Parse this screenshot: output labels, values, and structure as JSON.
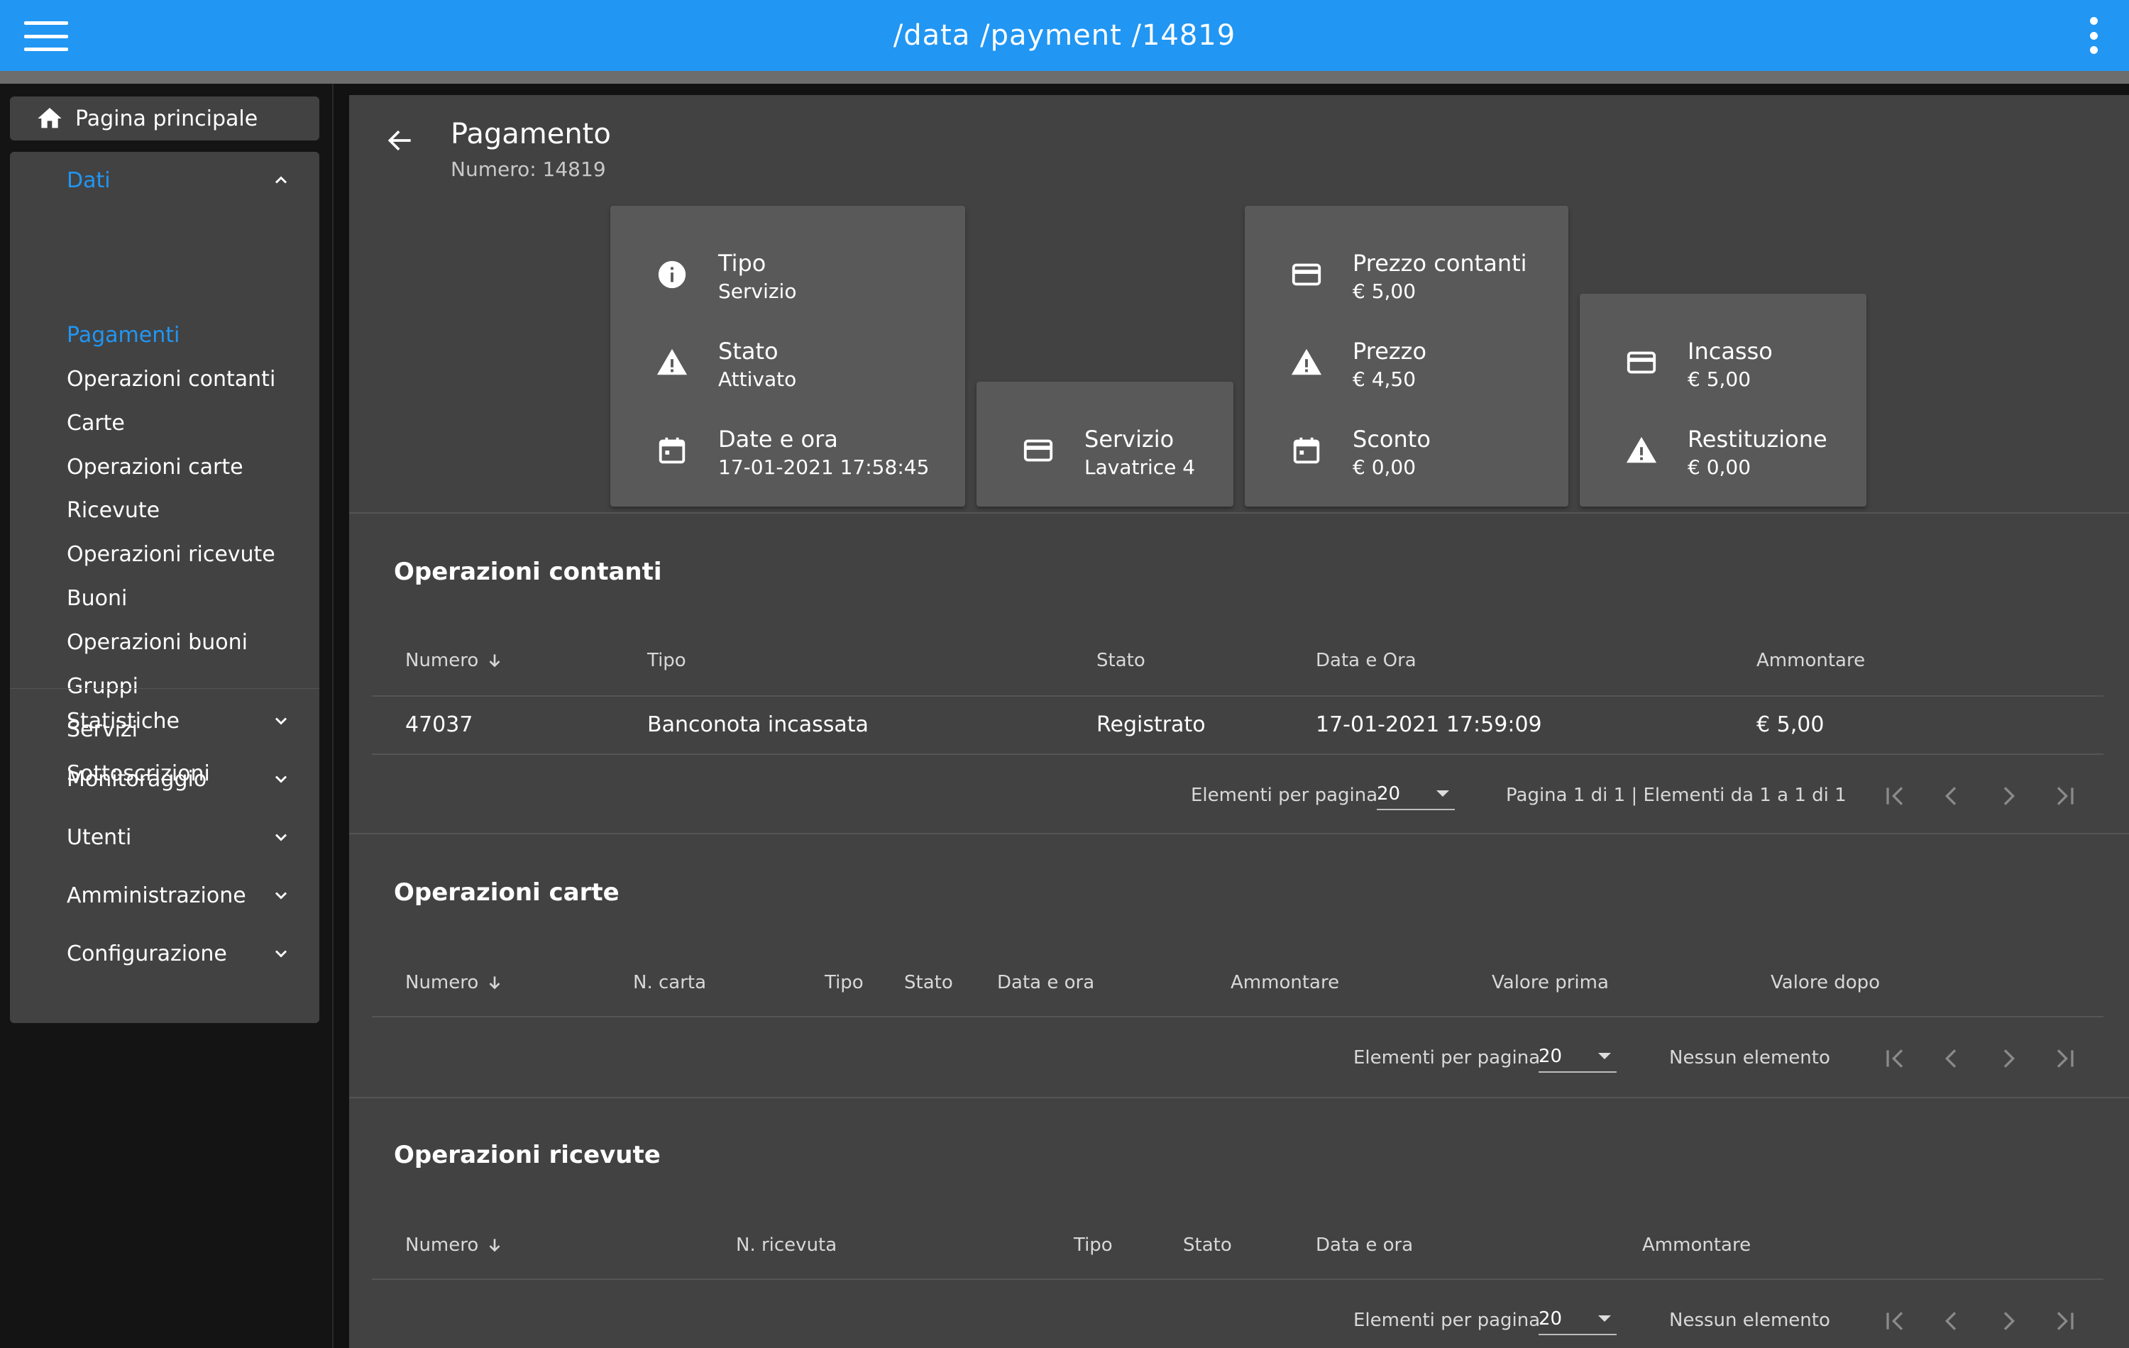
{
  "topbar": {
    "title": "/data /payment /14819"
  },
  "sidebar": {
    "home_label": "Pagina principale",
    "groups": [
      {
        "label": "Dati",
        "expanded": true,
        "items": [
          "Pagamenti",
          "Operazioni contanti",
          "Carte",
          "Operazioni carte",
          "Ricevute",
          "Operazioni ricevute",
          "Buoni",
          "Operazioni buoni",
          "Gruppi",
          "Servizi",
          "Sottoscrizioni"
        ],
        "active_item": "Pagamenti"
      },
      {
        "label": "Statistiche",
        "expanded": false
      },
      {
        "label": "Monitoraggio",
        "expanded": false
      },
      {
        "label": "Utenti",
        "expanded": false
      },
      {
        "label": "Amministrazione",
        "expanded": false
      },
      {
        "label": "Configurazione",
        "expanded": false
      }
    ]
  },
  "page": {
    "title": "Pagamento",
    "subtitle": "Numero: 14819"
  },
  "cards": {
    "card1": [
      {
        "icon": "info-icon",
        "label": "Tipo",
        "value": "Servizio"
      },
      {
        "icon": "warning-icon",
        "label": "Stato",
        "value": "Attivato"
      },
      {
        "icon": "calendar-icon",
        "label": "Date e ora",
        "value": "17-01-2021 17:58:45"
      }
    ],
    "card2": [
      {
        "icon": "credit-card-icon",
        "label": "Servizio",
        "value": "Lavatrice 4"
      }
    ],
    "card3": [
      {
        "icon": "credit-card-icon",
        "label": "Prezzo contanti",
        "value": "€ 5,00"
      },
      {
        "icon": "warning-icon",
        "label": "Prezzo",
        "value": "€ 4,50"
      },
      {
        "icon": "calendar-icon",
        "label": "Sconto",
        "value": "€ 0,00"
      }
    ],
    "card4": [
      {
        "icon": "credit-card-icon",
        "label": "Incasso",
        "value": "€ 5,00"
      },
      {
        "icon": "warning-icon",
        "label": "Restituzione",
        "value": "€ 0,00"
      }
    ]
  },
  "cash_ops": {
    "title": "Operazioni contanti",
    "columns": [
      "Numero",
      "Tipo",
      "Stato",
      "Data e Ora",
      "Ammontare"
    ],
    "rows": [
      {
        "numero": "47037",
        "tipo": "Banconota incassata",
        "stato": "Registrato",
        "data": "17-01-2021 17:59:09",
        "ammontare": "€ 5,00"
      }
    ],
    "per_page_label": "Elementi per pagina",
    "per_page": "20",
    "range_text": "Pagina 1 di 1 | Elementi da 1 a 1 di 1"
  },
  "card_ops": {
    "title": "Operazioni carte",
    "columns": [
      "Numero",
      "N. carta",
      "Tipo",
      "Stato",
      "Data e ora",
      "Ammontare",
      "Valore prima",
      "Valore dopo"
    ],
    "per_page_label": "Elementi per pagina",
    "per_page": "20",
    "range_text": "Nessun elemento"
  },
  "receipt_ops": {
    "title": "Operazioni ricevute",
    "columns": [
      "Numero",
      "N. ricevuta",
      "Tipo",
      "Stato",
      "Data e ora",
      "Ammontare"
    ],
    "per_page_label": "Elementi per pagina",
    "per_page": "20",
    "range_text": "Nessun elemento"
  },
  "colors": {
    "primary": "#2196f3",
    "surface": "#424242",
    "card": "#595959",
    "background": "#121212"
  }
}
